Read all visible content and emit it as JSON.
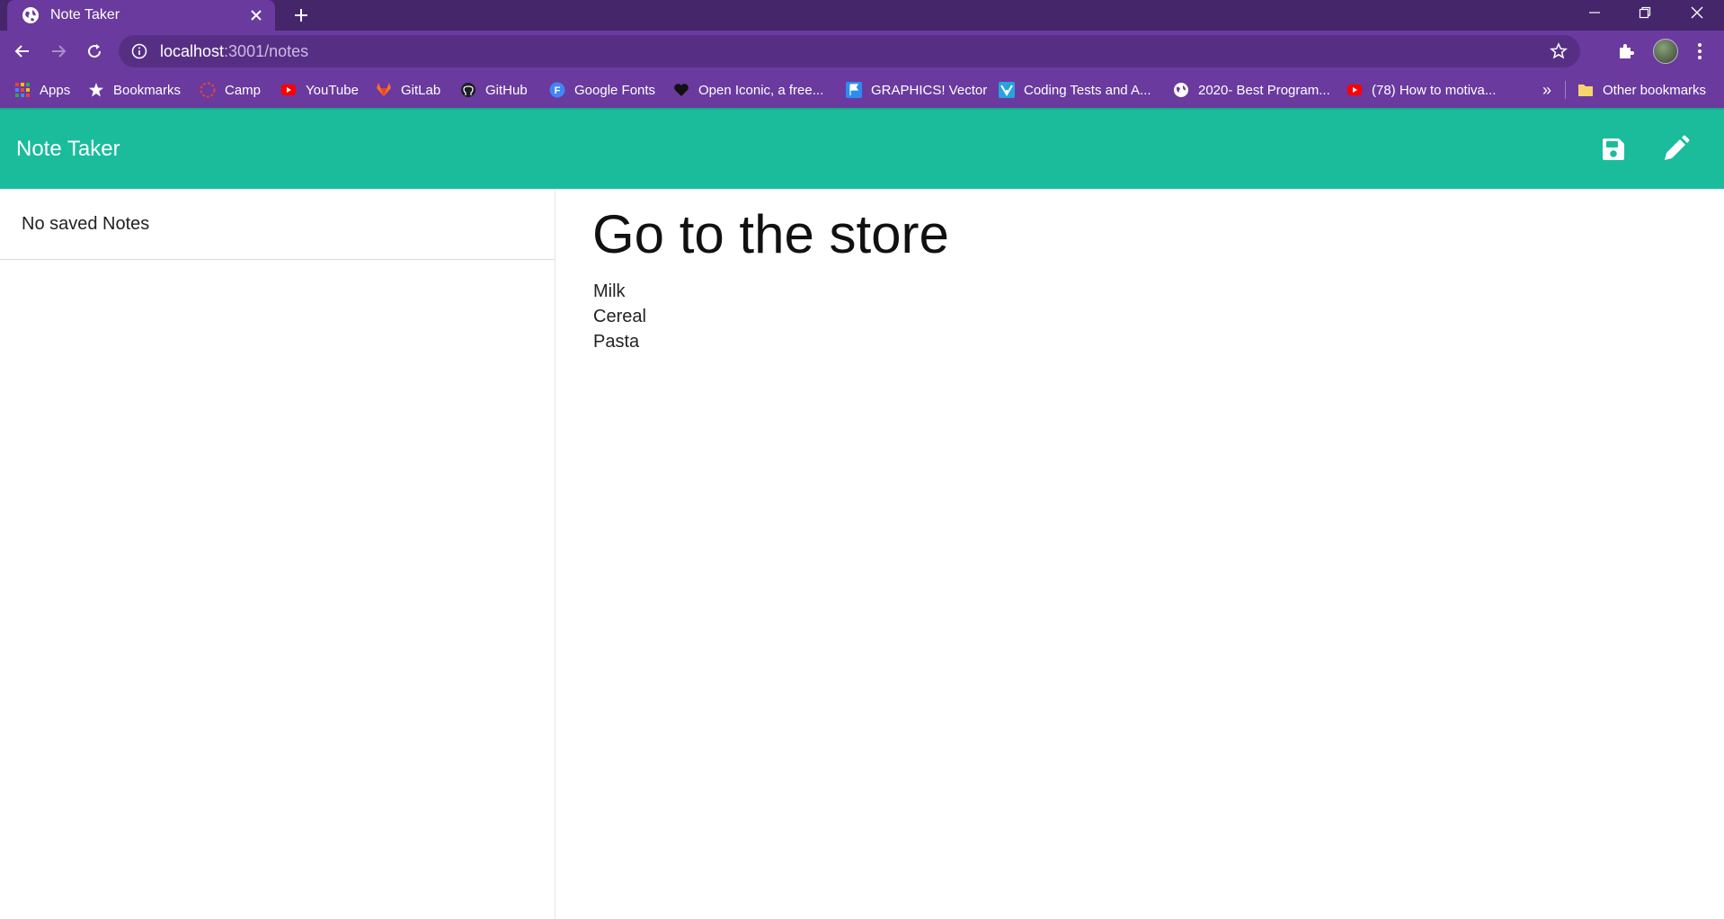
{
  "browser": {
    "tab_title": "Note Taker",
    "url_host": "localhost",
    "url_path": ":3001/notes",
    "bookmarks": [
      {
        "label": "Apps",
        "icon": "apps-grid-icon"
      },
      {
        "label": "Bookmarks",
        "icon": "star-icon"
      },
      {
        "label": "Camp",
        "icon": "camp-icon"
      },
      {
        "label": "YouTube",
        "icon": "youtube-icon"
      },
      {
        "label": "GitLab",
        "icon": "gitlab-icon"
      },
      {
        "label": "GitHub",
        "icon": "github-icon"
      },
      {
        "label": "Google Fonts",
        "icon": "google-fonts-icon"
      },
      {
        "label": "Open Iconic, a free...",
        "icon": "heart-icon"
      },
      {
        "label": "GRAPHICS! Vector",
        "icon": "flag-icon"
      },
      {
        "label": "Coding Tests and A...",
        "icon": "coding-tests-icon"
      },
      {
        "label": "2020- Best Program...",
        "icon": "globe-icon"
      },
      {
        "label": "(78) How to motiva...",
        "icon": "youtube-icon"
      }
    ],
    "overflow_label": "»",
    "other_bookmarks": "Other bookmarks"
  },
  "app": {
    "brand": "Note Taker",
    "accent_color": "#1abc9c",
    "sidebar": {
      "empty_message": "No saved Notes"
    },
    "note": {
      "title": "Go to the store",
      "lines": [
        "Milk",
        "Cereal",
        "Pasta"
      ]
    }
  }
}
